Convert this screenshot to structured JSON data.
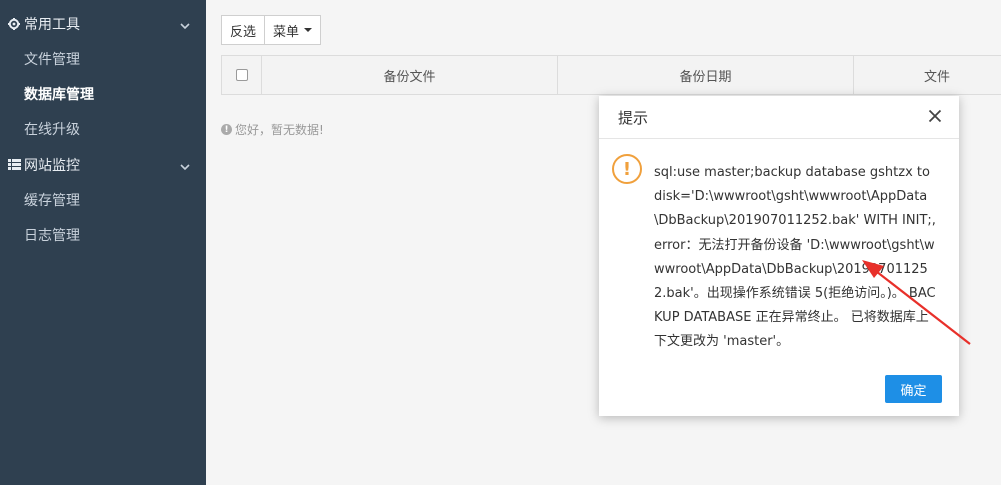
{
  "sidebar": {
    "groups": [
      {
        "label": "常用工具",
        "items": [
          {
            "label": "文件管理"
          },
          {
            "label": "数据库管理"
          },
          {
            "label": "在线升级"
          }
        ]
      },
      {
        "label": "网站监控",
        "items": [
          {
            "label": "缓存管理"
          },
          {
            "label": "日志管理"
          }
        ]
      }
    ]
  },
  "toolbar": {
    "invert_label": "反选",
    "menu_label": "菜单"
  },
  "table": {
    "columns": [
      "备份文件",
      "备份日期",
      "文件"
    ],
    "empty_text": "您好，暂无数据!"
  },
  "dialog": {
    "title": "提示",
    "message": "sql:use master;backup database gshtzx to disk='D:\\wwwroot\\gsht\\wwwroot\\AppData\\DbBackup\\201907011252.bak' WITH INIT;,error：无法打开备份设备 'D:\\wwwroot\\gsht\\wwwroot\\AppData\\DbBackup\\201907011252.bak'。出现操作系统错误 5(拒绝访问。)。 BACKUP DATABASE 正在异常终止。 已将数据库上下文更改为 'master'。",
    "ok_label": "确定"
  },
  "colors": {
    "sidebar_bg": "#2f4050",
    "primary_button": "#1e8fe6",
    "warning_icon": "#f0a03c",
    "annotation_arrow": "#e8302a"
  }
}
